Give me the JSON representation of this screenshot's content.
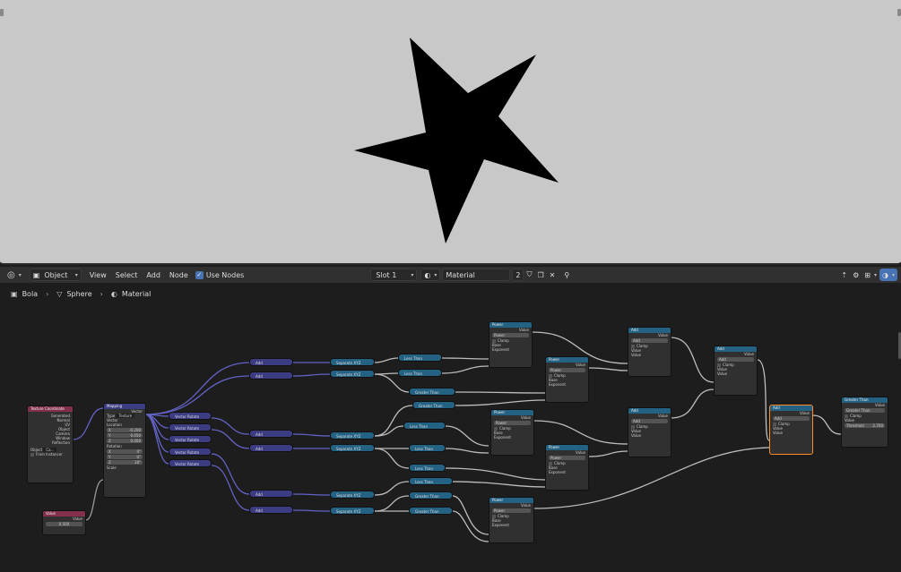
{
  "header": {
    "mode": "Object",
    "menus": [
      "View",
      "Select",
      "Add",
      "Node"
    ],
    "use_nodes": "Use Nodes",
    "slot": "Slot 1",
    "material_name": "Material",
    "user_count": "2"
  },
  "breadcrumb": [
    "Bola",
    "Sphere",
    "Material"
  ],
  "nodes": {
    "texcoord": {
      "title": "Texture Coordinate",
      "outputs": [
        "Generated",
        "Normal",
        "UV",
        "Object",
        "Camera",
        "Window",
        "Reflection"
      ],
      "object_label": "Object",
      "object_value": "Ca...",
      "from_instancer": "From Instancer"
    },
    "mapping": {
      "title": "Mapping",
      "out": "Vector",
      "type_label": "Type",
      "type_value": "Texture",
      "vector": "Vector",
      "location": "Location",
      "loc": [
        "-0.200",
        "0.050",
        "0.000"
      ],
      "rotation": "Rotation",
      "rot": [
        "0°",
        "0°",
        "18°"
      ],
      "scale": "Scale",
      "axes": [
        "X",
        "Y",
        "Z"
      ]
    },
    "value": {
      "title": "Value",
      "out": "Value",
      "val": "0.500"
    },
    "vector_rotate": "Vector Rotate",
    "add": "Add",
    "separate": "Separate XYZ",
    "less": "Less Than",
    "greater": "Greater Than",
    "power": {
      "title": "Power",
      "op": "Power",
      "clamp": "Clamp",
      "base": "Base",
      "exponent": "Exponent",
      "out": "Value"
    },
    "mathadd": {
      "title": "Add",
      "op": "Add",
      "clamp": "Clamp",
      "in": "Value",
      "out": "Value"
    },
    "final_gt": {
      "title": "Greater Than",
      "op": "Greater Than",
      "clamp": "Clamp",
      "out": "Value",
      "in": "Value",
      "threshold": "Threshold",
      "threshold_val": "2.700"
    }
  },
  "colors": {
    "viewport": "#c8c8c8",
    "star": "#000000",
    "input_header": "#83314a",
    "vector_header": "#3c3c83",
    "converter_header": "#246283",
    "active_outline": "#ff8c28"
  }
}
